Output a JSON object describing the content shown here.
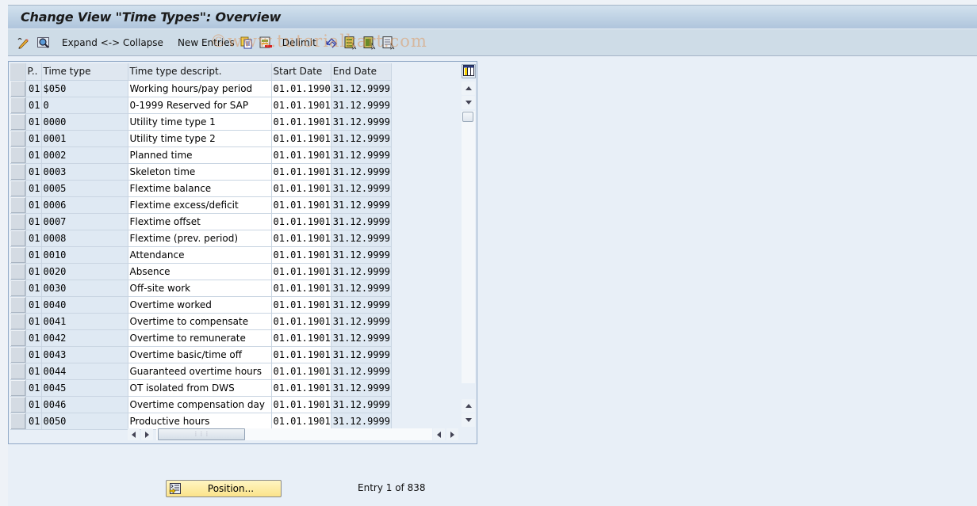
{
  "window": {
    "title": "Change View \"Time Types\": Overview"
  },
  "toolbar": {
    "items": [
      {
        "type": "icon",
        "name": "display-change-icon"
      },
      {
        "type": "icon",
        "name": "find-icon"
      },
      {
        "type": "text",
        "label": "Expand <-> Collapse"
      },
      {
        "type": "text",
        "label": "New Entries"
      },
      {
        "type": "icon",
        "name": "copy-as-icon"
      },
      {
        "type": "icon",
        "name": "delete-icon"
      },
      {
        "type": "text",
        "label": "Delimit"
      },
      {
        "type": "icon",
        "name": "undo-change-icon"
      },
      {
        "type": "icon",
        "name": "select-all-icon"
      },
      {
        "type": "icon",
        "name": "select-block-icon"
      },
      {
        "type": "icon",
        "name": "deselect-all-icon"
      }
    ],
    "watermark": "©www.tutorialkart.com"
  },
  "table": {
    "columns": [
      "P..",
      "Time type",
      "Time type descript.",
      "Start Date",
      "End Date"
    ],
    "rows": [
      {
        "p": "01",
        "type": "$050",
        "desc": "Working hours/pay period",
        "start": "01.01.1990",
        "end": "31.12.9999"
      },
      {
        "p": "01",
        "type": "0",
        "desc": "0-1999 Reserved for SAP",
        "start": "01.01.1901",
        "end": "31.12.9999"
      },
      {
        "p": "01",
        "type": "0000",
        "desc": "Utility time type 1",
        "start": "01.01.1901",
        "end": "31.12.9999"
      },
      {
        "p": "01",
        "type": "0001",
        "desc": "Utility time type 2",
        "start": "01.01.1901",
        "end": "31.12.9999"
      },
      {
        "p": "01",
        "type": "0002",
        "desc": "Planned time",
        "start": "01.01.1901",
        "end": "31.12.9999"
      },
      {
        "p": "01",
        "type": "0003",
        "desc": "Skeleton time",
        "start": "01.01.1901",
        "end": "31.12.9999"
      },
      {
        "p": "01",
        "type": "0005",
        "desc": "Flextime balance",
        "start": "01.01.1901",
        "end": "31.12.9999"
      },
      {
        "p": "01",
        "type": "0006",
        "desc": "Flextime excess/deficit",
        "start": "01.01.1901",
        "end": "31.12.9999"
      },
      {
        "p": "01",
        "type": "0007",
        "desc": "Flextime offset",
        "start": "01.01.1901",
        "end": "31.12.9999"
      },
      {
        "p": "01",
        "type": "0008",
        "desc": "Flextime (prev. period)",
        "start": "01.01.1901",
        "end": "31.12.9999"
      },
      {
        "p": "01",
        "type": "0010",
        "desc": "Attendance",
        "start": "01.01.1901",
        "end": "31.12.9999"
      },
      {
        "p": "01",
        "type": "0020",
        "desc": "Absence",
        "start": "01.01.1901",
        "end": "31.12.9999"
      },
      {
        "p": "01",
        "type": "0030",
        "desc": "Off-site work",
        "start": "01.01.1901",
        "end": "31.12.9999"
      },
      {
        "p": "01",
        "type": "0040",
        "desc": "Overtime worked",
        "start": "01.01.1901",
        "end": "31.12.9999"
      },
      {
        "p": "01",
        "type": "0041",
        "desc": "Overtime to compensate",
        "start": "01.01.1901",
        "end": "31.12.9999"
      },
      {
        "p": "01",
        "type": "0042",
        "desc": "Overtime to remunerate",
        "start": "01.01.1901",
        "end": "31.12.9999"
      },
      {
        "p": "01",
        "type": "0043",
        "desc": "Overtime basic/time off",
        "start": "01.01.1901",
        "end": "31.12.9999"
      },
      {
        "p": "01",
        "type": "0044",
        "desc": "Guaranteed overtime hours",
        "start": "01.01.1901",
        "end": "31.12.9999"
      },
      {
        "p": "01",
        "type": "0045",
        "desc": "OT isolated from DWS",
        "start": "01.01.1901",
        "end": "31.12.9999"
      },
      {
        "p": "01",
        "type": "0046",
        "desc": "Overtime compensation day",
        "start": "01.01.1901",
        "end": "31.12.9999"
      },
      {
        "p": "01",
        "type": "0050",
        "desc": "Productive hours",
        "start": "01.01.1901",
        "end": "31.12.9999"
      }
    ]
  },
  "footer": {
    "position_button": "Position...",
    "entry_info": "Entry 1 of 838"
  }
}
